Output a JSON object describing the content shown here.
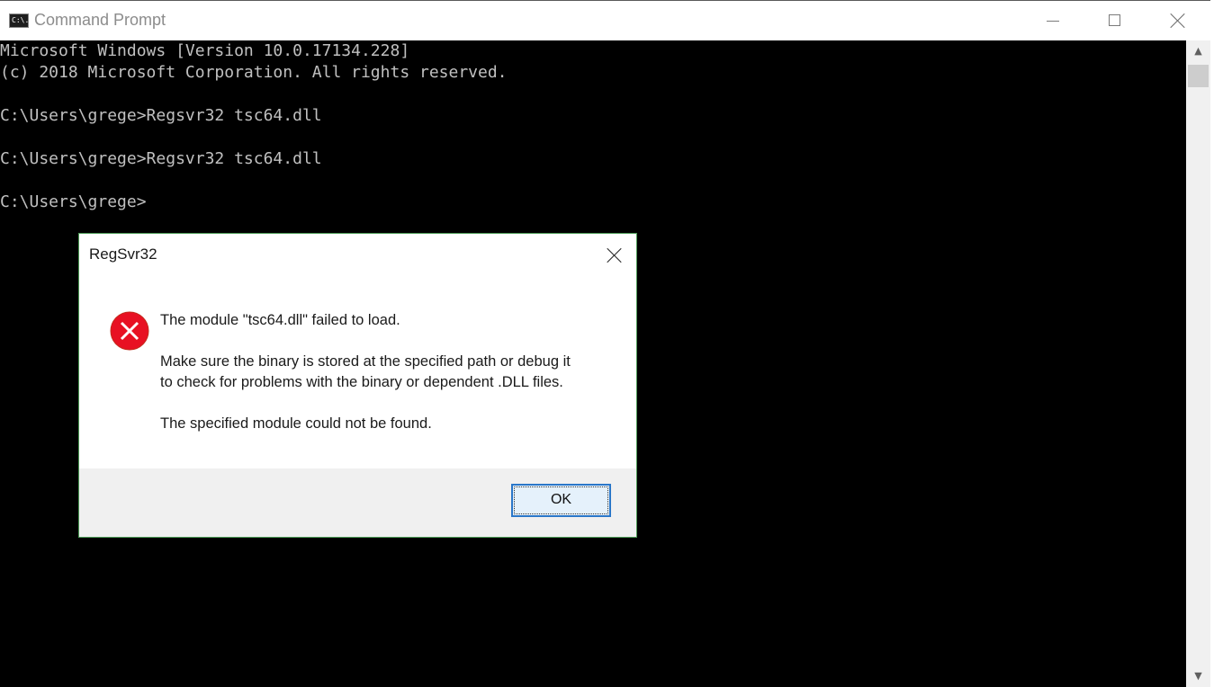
{
  "window": {
    "title": "Command Prompt",
    "icon_text": "C:\\.",
    "controls": [
      "minimize-icon",
      "maximize-icon",
      "close-icon"
    ]
  },
  "console": {
    "lines": [
      "Microsoft Windows [Version 10.0.17134.228]",
      "(c) 2018 Microsoft Corporation. All rights reserved.",
      "",
      "C:\\Users\\grege>Regsvr32 tsc64.dll",
      "",
      "C:\\Users\\grege>Regsvr32 tsc64.dll",
      "",
      "C:\\Users\\grege>"
    ]
  },
  "scrollbar": {
    "up_arrow": "▲",
    "down_arrow": "▼"
  },
  "dialog": {
    "title": "RegSvr32",
    "icon": "error-icon",
    "message_line1": "The module \"tsc64.dll\" failed to load.",
    "message_line2a": "Make sure the binary is stored at the specified path or debug it",
    "message_line2b": "to check for problems with the binary or dependent .DLL files.",
    "message_line3": "The specified module could not be found.",
    "ok_label": "OK"
  },
  "colors": {
    "console_bg": "#000000",
    "console_text": "#c0c0c0",
    "error_red": "#e81123",
    "dialog_border": "#4c9a56",
    "ok_border": "#2a77c9"
  }
}
